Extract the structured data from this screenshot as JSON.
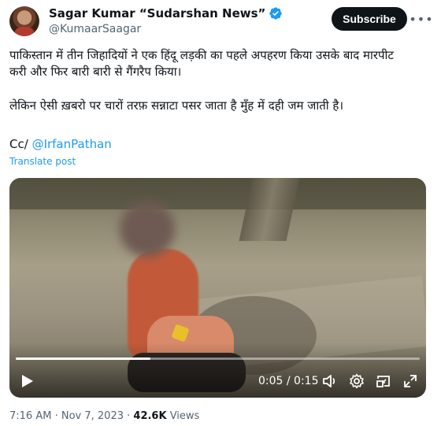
{
  "author": {
    "name": "Sagar Kumar “Sudarshan News”",
    "handle": "@KumaarSaagar",
    "verified": true
  },
  "actions": {
    "subscribe_label": "Subscribe",
    "more_label": "•••"
  },
  "tweet": {
    "line1": "पाकिस्तान में तीन जिहादियों ने एक हिंदू लड़की का पहले अपहरण किया उसके बाद मारपीट करी और फिर बारी बारी से गैंगरैप किया।",
    "line2": "लेकिन ऐसी ख़बरो पर चारों तरफ़ सन्नाटा पसर जाता है मुँह में दही जम जाती है।",
    "cc_prefix": "Cc/",
    "mention": "@IrfanPathan",
    "translate_label": "Translate post"
  },
  "video": {
    "timecode": "0:05 / 0:15",
    "progress_fraction": 0.333
  },
  "footer": {
    "time": "7:16 AM",
    "sep1": "·",
    "date": "Nov 7, 2023",
    "sep2": "·",
    "views_count": "42.6K",
    "views_label": "Views"
  },
  "colors": {
    "accent": "#1d9bf0",
    "text": "#0f1419",
    "muted": "#536471"
  },
  "icons": [
    "verified-badge-icon",
    "more-icon",
    "play-icon",
    "volume-icon",
    "settings-gear-icon",
    "picture-in-picture-icon",
    "fullscreen-icon"
  ]
}
